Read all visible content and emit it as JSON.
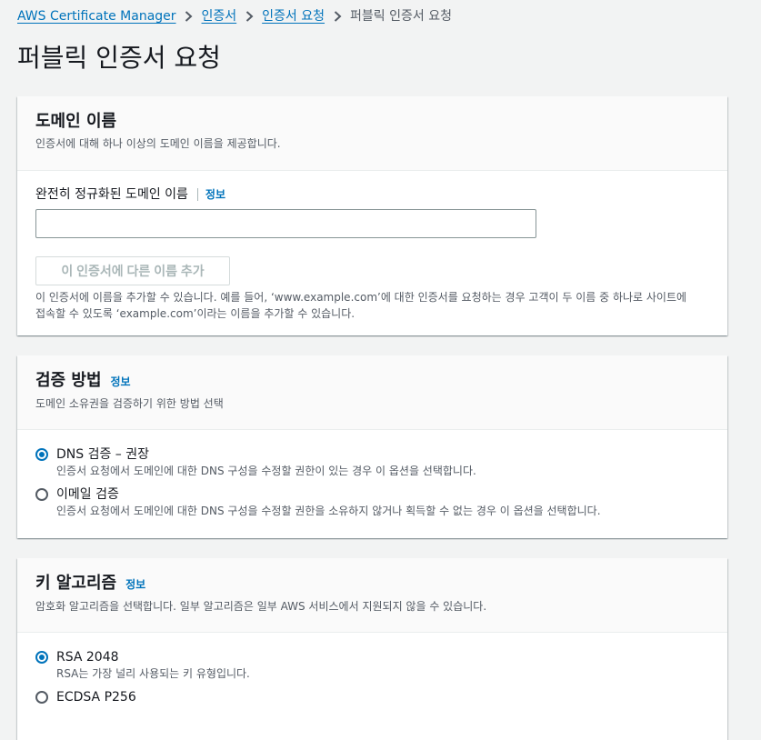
{
  "breadcrumb": {
    "items": [
      "AWS Certificate Manager",
      "인증서",
      "인증서 요청"
    ],
    "current": "퍼블릭 인증서 요청"
  },
  "page_title": "퍼블릭 인증서 요청",
  "domain_panel": {
    "title": "도메인 이름",
    "description": "인증서에 대해 하나 이상의 도메인 이름을 제공합니다.",
    "field_label": "완전히 정규화된 도메인 이름",
    "info_label": "정보",
    "input_value": "",
    "add_button_label": "이 인증서에 다른 이름 추가",
    "help_line1": "이 인증서에 이름을 추가할 수 있습니다. 예를 들어, ‘www.example.com’에 대한 인증서를 요청하는 경우 고객이 두 이름 중 하나로 사이트에",
    "help_line2": "접속할 수 있도록 ‘example.com’이라는 이름을 추가할 수 있습니다."
  },
  "validation_panel": {
    "title": "검증 방법",
    "info_label": "정보",
    "description": "도메인 소유권을 검증하기 위한 방법 선택",
    "options": [
      {
        "label": "DNS 검증 – 권장",
        "description": "인증서 요청에서 도메인에 대한 DNS 구성을 수정할 권한이 있는 경우 이 옵션을 선택합니다.",
        "selected": true
      },
      {
        "label": "이메일 검증",
        "description": "인증서 요청에서 도메인에 대한 DNS 구성을 수정할 권한을 소유하지 않거나 획득할 수 없는 경우 이 옵션을 선택합니다.",
        "selected": false
      }
    ]
  },
  "key_panel": {
    "title": "키 알고리즘",
    "info_label": "정보",
    "description": "암호화 알고리즘을 선택합니다. 일부 알고리즘은 일부 AWS 서비스에서 지원되지 않을 수 있습니다.",
    "options": [
      {
        "label": "RSA 2048",
        "description": "RSA는 가장 널리 사용되는 키 유형입니다.",
        "selected": true
      },
      {
        "label": "ECDSA P256",
        "description": "",
        "selected": false
      }
    ]
  },
  "colors": {
    "link": "#0073bb",
    "text": "#16191f",
    "muted": "#545b64",
    "page_bg": "#f2f3f3",
    "panel_header_bg": "#fafafa"
  }
}
